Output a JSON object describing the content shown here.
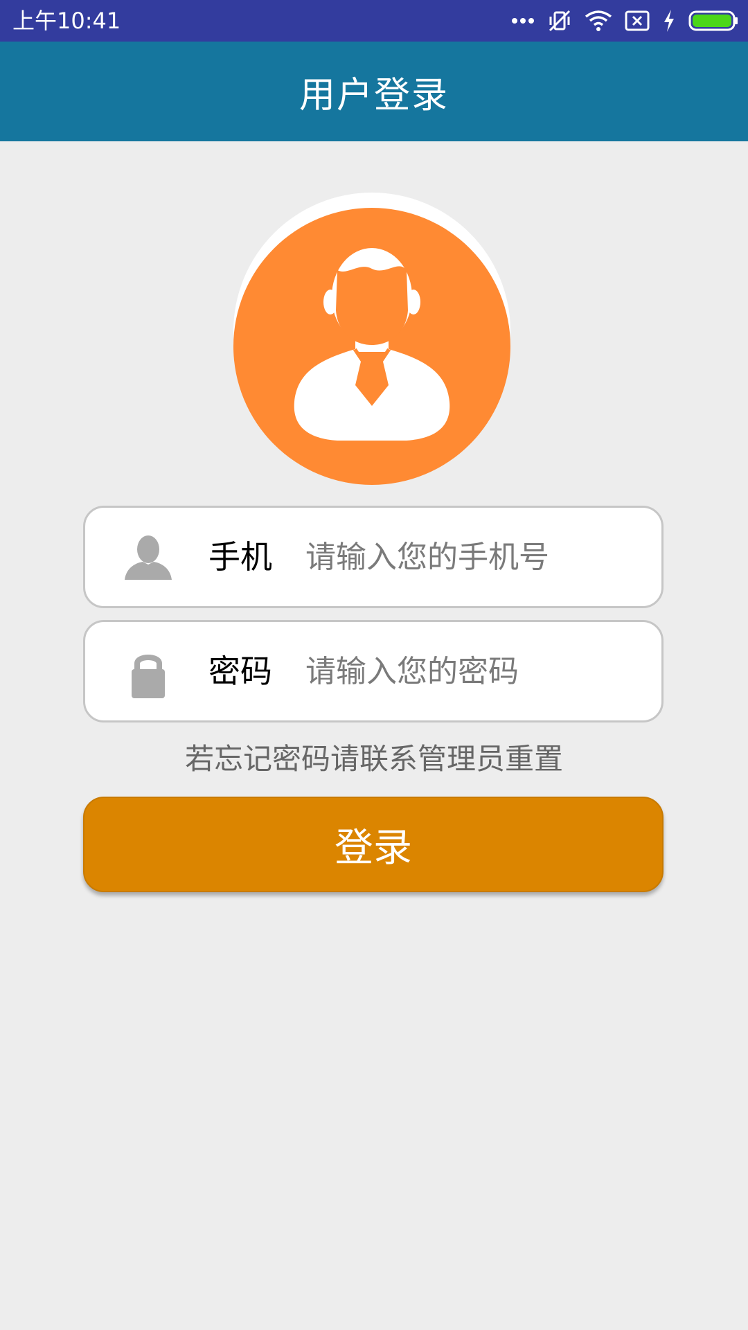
{
  "status_bar": {
    "time": "上午10:41",
    "icons": [
      "more-dots-icon",
      "vibrate-silent-icon",
      "wifi-icon",
      "sim-none-icon",
      "charging-bolt-icon",
      "battery-icon"
    ]
  },
  "header": {
    "title": "用户登录"
  },
  "avatar": {
    "icon": "user-avatar-icon",
    "background_color": "#ff8a33"
  },
  "form": {
    "phone": {
      "icon": "person-icon",
      "label": "手机",
      "placeholder": "请输入您的手机号",
      "value": ""
    },
    "password": {
      "icon": "lock-icon",
      "label": "密码",
      "placeholder": "请输入您的密码",
      "value": ""
    },
    "hint": "若忘记密码请联系管理员重置",
    "submit_label": "登录"
  },
  "colors": {
    "status_bar": "#333c9e",
    "header": "#15769e",
    "background": "#ededed",
    "button": "#db8500"
  }
}
